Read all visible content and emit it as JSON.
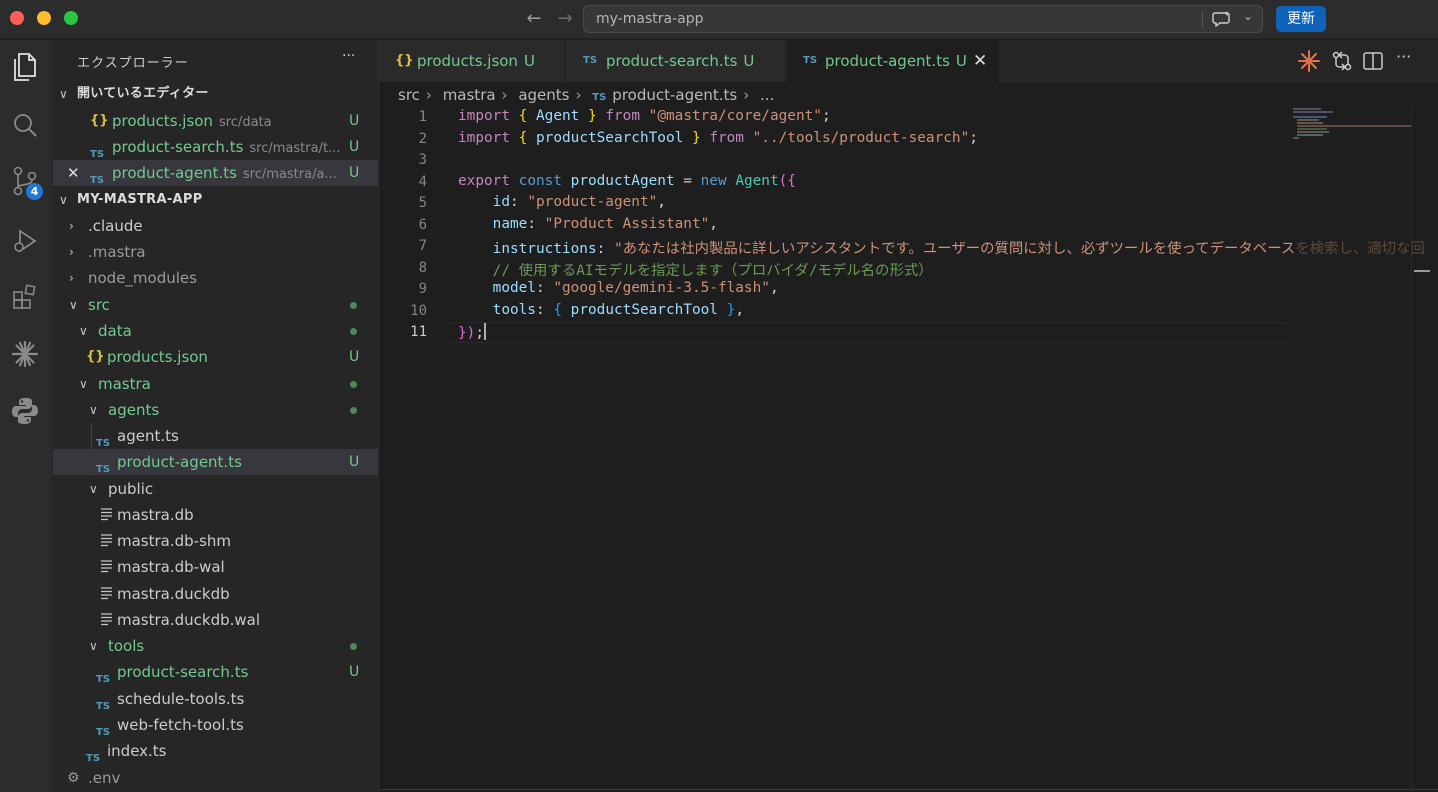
{
  "window": {
    "title": "my-mastra-app",
    "update_button": "更新"
  },
  "activity_bar": {
    "items": [
      "explorer-icon",
      "search-icon",
      "source-control-icon",
      "run-debug-icon",
      "extensions-icon",
      "sparkle-icon",
      "python-icon"
    ],
    "source_control_badge": "4"
  },
  "sidebar": {
    "title": "エクスプローラー",
    "more": "···",
    "open_editors": {
      "header": "開いているエディター",
      "items": [
        {
          "icon": "{}",
          "name": "products.json",
          "path": "src/data",
          "status": "U"
        },
        {
          "icon": "TS",
          "name": "product-search.ts",
          "path": "src/mastra/t...",
          "status": "U"
        },
        {
          "icon": "TS",
          "name": "product-agent.ts",
          "path": "src/mastra/a...",
          "status": "U"
        }
      ]
    },
    "project": {
      "header": "MY-MASTRA-APP",
      "items": [
        {
          "name": ".claude"
        },
        {
          "name": ".mastra"
        },
        {
          "name": "node_modules"
        },
        {
          "name": "src"
        },
        {
          "name": "data"
        },
        {
          "name": "products.json",
          "icon": "{}",
          "status": "U"
        },
        {
          "name": "mastra"
        },
        {
          "name": "agents"
        },
        {
          "name": "agent.ts",
          "icon": "TS"
        },
        {
          "name": "product-agent.ts",
          "icon": "TS",
          "status": "U"
        },
        {
          "name": "public"
        },
        {
          "name": "mastra.db"
        },
        {
          "name": "mastra.db-shm"
        },
        {
          "name": "mastra.db-wal"
        },
        {
          "name": "mastra.duckdb"
        },
        {
          "name": "mastra.duckdb.wal"
        },
        {
          "name": "tools"
        },
        {
          "name": "product-search.ts",
          "icon": "TS",
          "status": "U"
        },
        {
          "name": "schedule-tools.ts",
          "icon": "TS"
        },
        {
          "name": "web-fetch-tool.ts",
          "icon": "TS"
        },
        {
          "name": "index.ts",
          "icon": "TS"
        },
        {
          "name": ".env"
        }
      ]
    }
  },
  "tabs": [
    {
      "icon": "{}",
      "label": "products.json",
      "status": "U"
    },
    {
      "icon": "TS",
      "label": "product-search.ts",
      "status": "U"
    },
    {
      "icon": "TS",
      "label": "product-agent.ts",
      "status": "U",
      "close": "✕"
    }
  ],
  "breadcrumb": [
    "src",
    "mastra",
    "agents",
    "TS",
    "product-agent.ts",
    "..."
  ],
  "editor": {
    "line_numbers": [
      "1",
      "2",
      "3",
      "4",
      "5",
      "6",
      "7",
      "8",
      "9",
      "10",
      "11"
    ],
    "lines": {
      "l1": {
        "import": "import",
        "ob": "{",
        "agent": "Agent",
        "cb": "}",
        "from": "from",
        "str": "\"@mastra/core/agent\"",
        "end": ";"
      },
      "l2": {
        "import": "import",
        "ob": "{",
        "tool": "productSearchTool",
        "cb": "}",
        "from": "from",
        "str": "\"../tools/product-search\"",
        "end": ";"
      },
      "l4": {
        "export": "export",
        "const": "const",
        "name": "productAgent",
        "eq": "=",
        "new": "new",
        "cls": "Agent",
        "open": "({"
      },
      "l5": {
        "key": "id",
        "colon": ":",
        "val": "\"product-agent\"",
        "comma": ","
      },
      "l6": {
        "key": "name",
        "colon": ":",
        "val": "\"Product Assistant\"",
        "comma": ","
      },
      "l7": {
        "key": "instructions",
        "colon": ":",
        "val": "\"あなたは社内製品に詳しいアシスタントです。ユーザーの質問に対し、必ずツールを使ってデータベース",
        "fade": "を検索し、適切な回"
      },
      "l8": {
        "comment": "// 使用するAIモデルを指定します（プロバイダ/モデル名の形式）"
      },
      "l9": {
        "key": "model",
        "colon": ":",
        "val": "\"google/gemini-3.5-flash\"",
        "comma": ","
      },
      "l10": {
        "key": "tools",
        "colon": ":",
        "ob": "{",
        "tool": "productSearchTool",
        "cb": "}",
        "comma": ","
      },
      "l11": {
        "cb": "}",
        "cp": ")",
        "end": ";"
      }
    }
  }
}
